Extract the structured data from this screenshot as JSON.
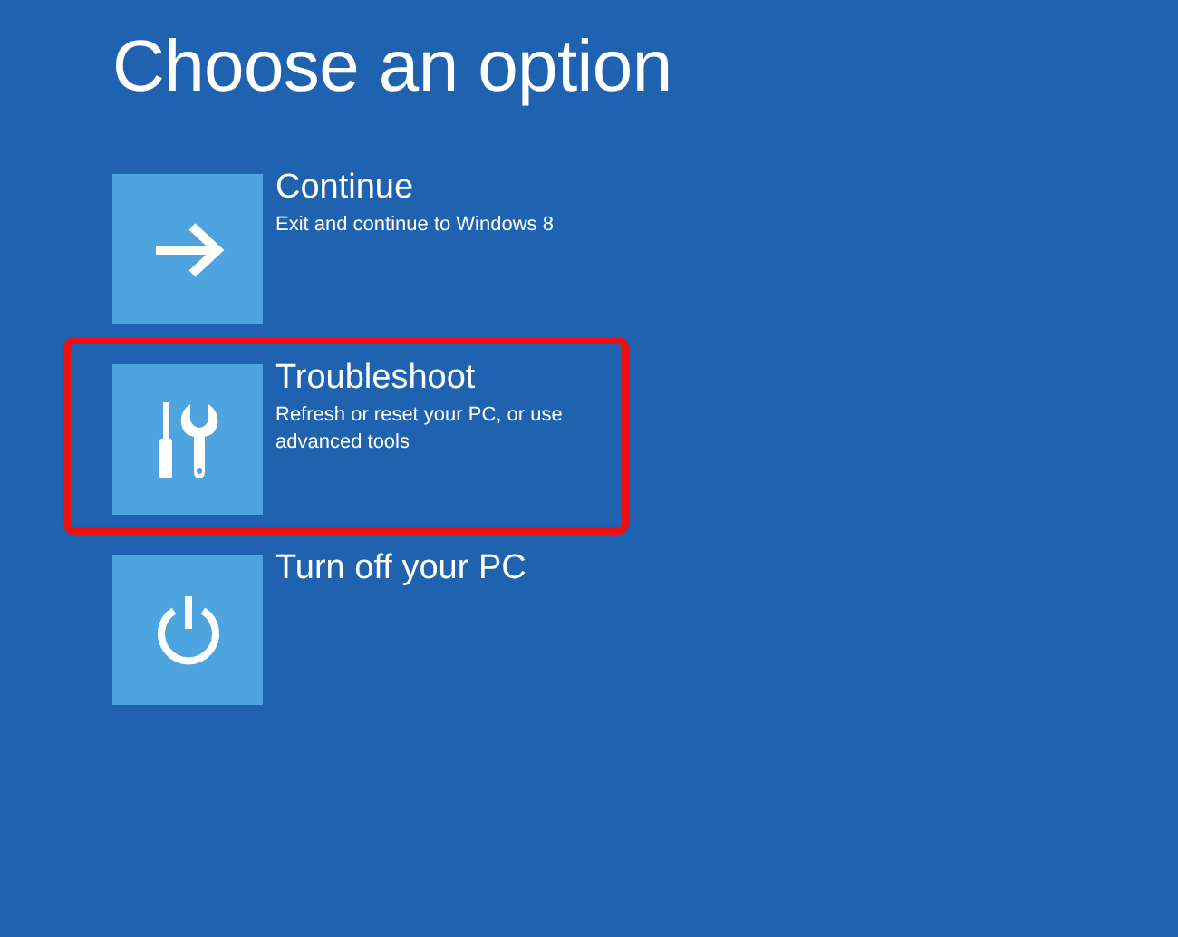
{
  "title": "Choose an option",
  "options": [
    {
      "kind": "arrow",
      "name": "Continue",
      "description": "Exit and continue to Windows 8",
      "highlighted": false
    },
    {
      "kind": "tools",
      "name": "Troubleshoot",
      "description": "Refresh or reset your PC, or use advanced tools",
      "highlighted": true
    },
    {
      "kind": "power",
      "name": "Turn off your PC",
      "highlighted": false
    }
  ]
}
